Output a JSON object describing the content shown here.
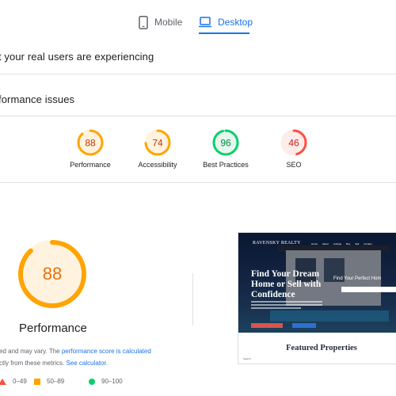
{
  "tabs": {
    "mobile_label": "Mobile",
    "desktop_label": "Desktop",
    "mobile_icon": "phone-icon",
    "desktop_icon": "laptop-icon",
    "active": "Desktop"
  },
  "sections": {
    "real_users": "t your real users are experiencing",
    "diagnose": "formance issues"
  },
  "scores": [
    {
      "label": "Performance",
      "value": "88",
      "color": "#ffa400",
      "text_color": "#c33300",
      "fraction": 0.88
    },
    {
      "label": "Accessibility",
      "value": "74",
      "color": "#ffa400",
      "text_color": "#c33300",
      "fraction": 0.74
    },
    {
      "label": "Best Practices",
      "value": "96",
      "color": "#0cce6b",
      "text_color": "#018642",
      "fraction": 0.96
    },
    {
      "label": "SEO",
      "value": "46",
      "color": "#ff4e42",
      "text_color": "#c7221f",
      "fraction": 0.46
    }
  ],
  "main_score": {
    "value": "88",
    "title": "Performance",
    "fraction": 0.88,
    "color": "#ffa400"
  },
  "description": {
    "part1": "ed and may vary. The ",
    "link1": "performance score is calculated",
    "part2": "ctly from these metrics. ",
    "link2": "See calculator",
    "part3": "."
  },
  "legend": [
    {
      "range": "0–49",
      "shape": "triangle",
      "color": "#ff4e42"
    },
    {
      "range": "50–89",
      "shape": "square",
      "color": "#ffa400"
    },
    {
      "range": "90–100",
      "shape": "circle",
      "color": "#0cce6b"
    }
  ],
  "screenshot": {
    "logo": "RAVENSKY REALTY",
    "nav": [
      "Home",
      "About",
      "Listings",
      "Buy",
      "Sell",
      "Contact"
    ],
    "heading": "Find Your Dream Home or Sell with Confidence",
    "find_text": "Find Your Perfect Hom",
    "featured": "Featured Properties",
    "footer": "Search"
  }
}
